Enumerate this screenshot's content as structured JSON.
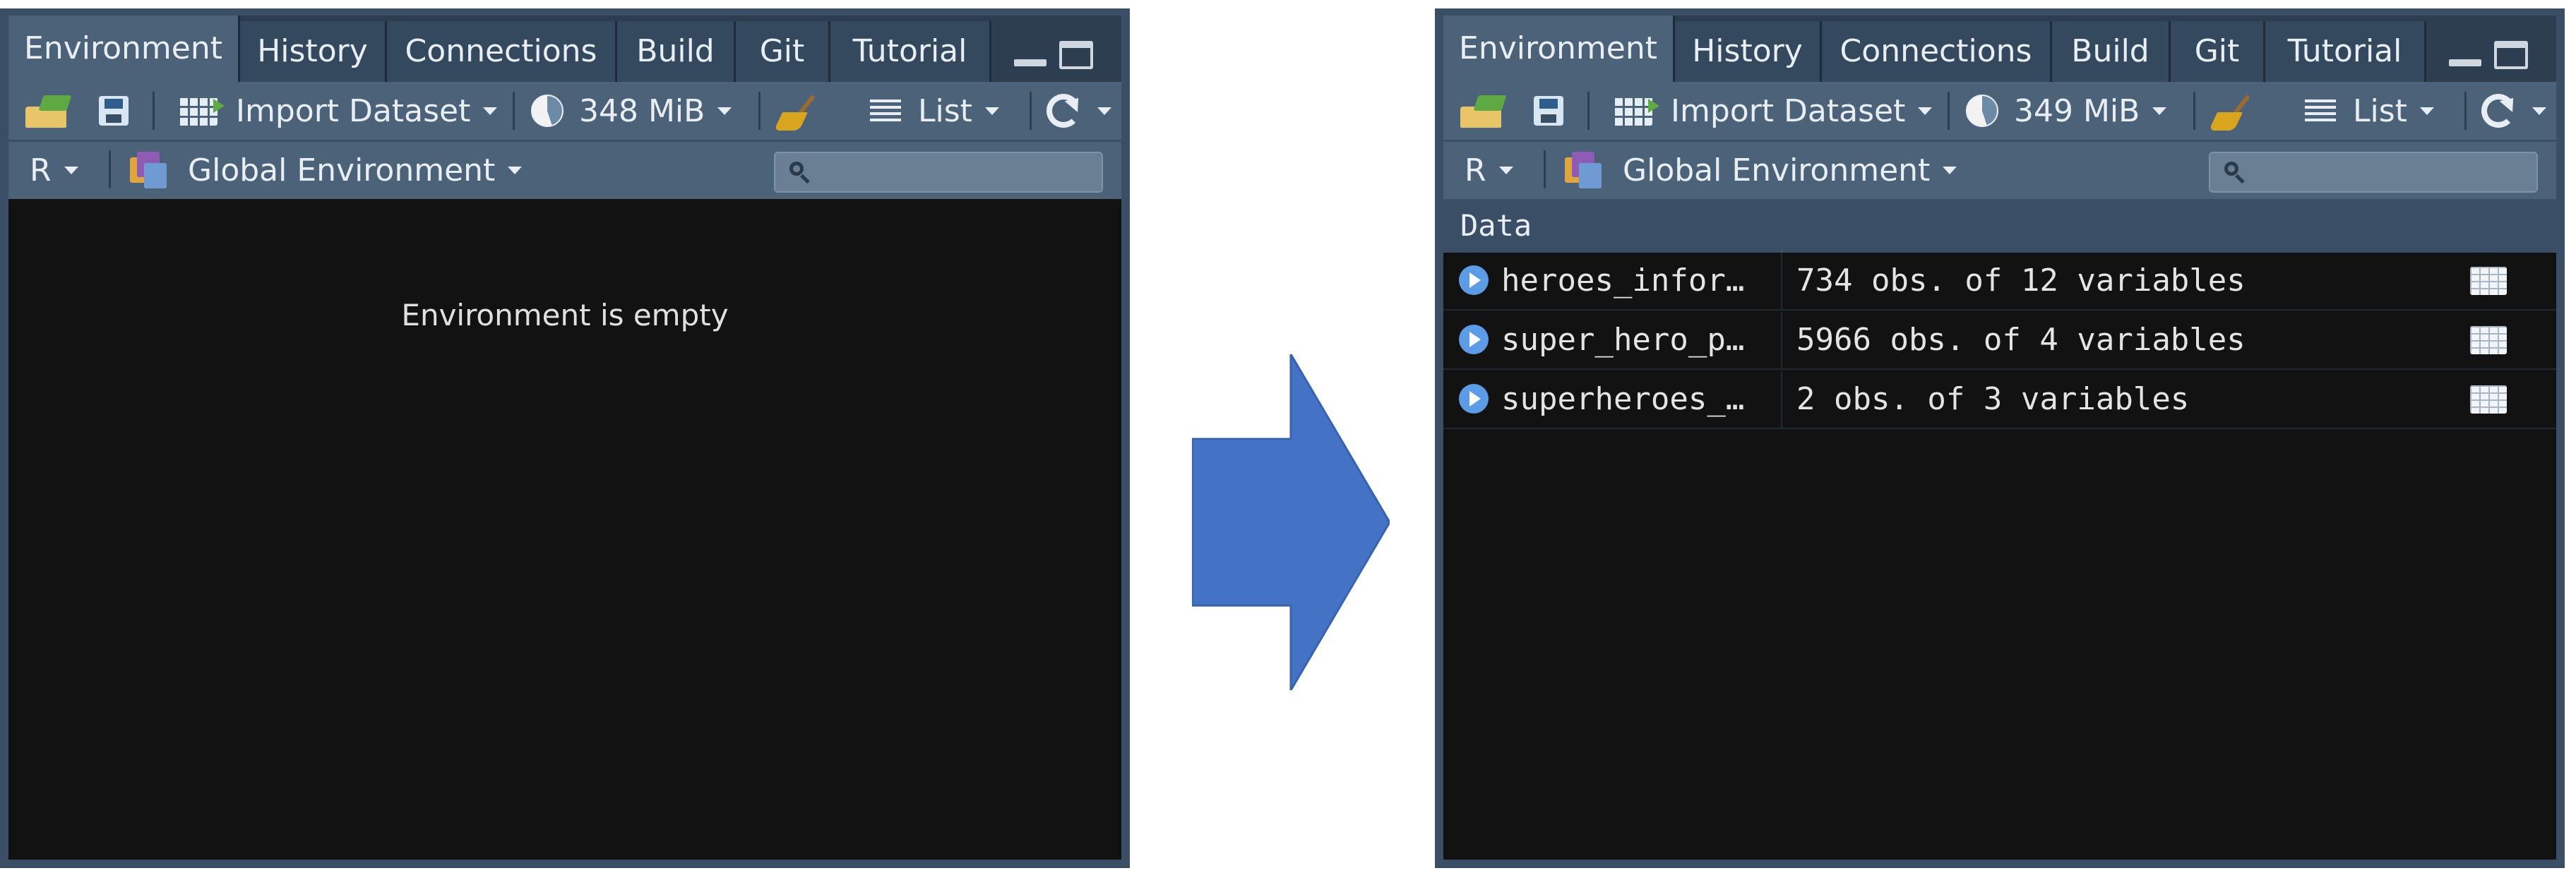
{
  "colors": {
    "pane_frame": "#3a4f66",
    "toolbar": "#4b6278",
    "panel_bg": "#121212",
    "arrow": "#4472c4"
  },
  "tabs": [
    "Environment",
    "History",
    "Connections",
    "Build",
    "Git",
    "Tutorial"
  ],
  "toolbar": {
    "import_label": "Import Dataset",
    "view_label": "List",
    "language_label": "R",
    "environment_label": "Global Environment",
    "icons": [
      "open-folder-icon",
      "save-icon",
      "import-dataset-icon",
      "memory-pie-icon",
      "broom-icon",
      "list-icon",
      "refresh-icon",
      "environment-icon",
      "search-icon"
    ]
  },
  "before": {
    "memory_label": "348 MiB",
    "empty_message": "Environment is empty"
  },
  "after": {
    "memory_label": "349 MiB",
    "section_header": "Data",
    "rows": [
      {
        "name": "heroes_infor…",
        "desc": "734 obs. of 12 variables"
      },
      {
        "name": "super_hero_p…",
        "desc": "5966 obs. of 4 variables"
      },
      {
        "name": "superheroes_…",
        "desc": "2 obs. of 3 variables"
      }
    ]
  }
}
